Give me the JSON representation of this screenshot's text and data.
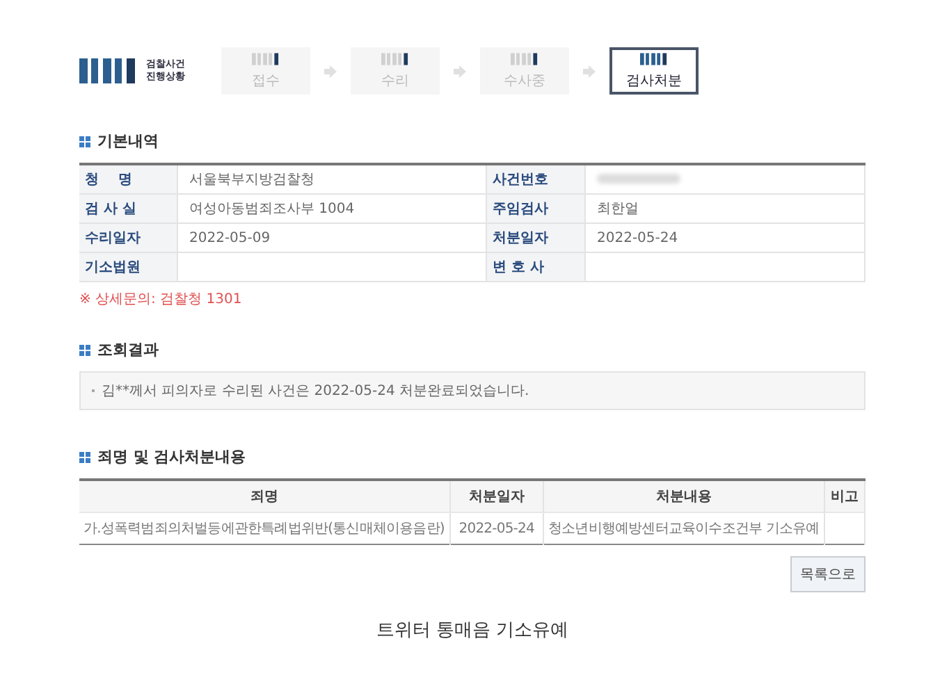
{
  "progress": {
    "title_lines": [
      "검찰사건",
      "진행상황"
    ],
    "steps": [
      {
        "label": "접수",
        "selected": false
      },
      {
        "label": "수리",
        "selected": false
      },
      {
        "label": "수사중",
        "selected": false
      },
      {
        "label": "검사처분",
        "selected": true
      }
    ]
  },
  "basic_info": {
    "title": "기본내역",
    "rows": [
      [
        {
          "label": "청    명",
          "value": "서울북부지방검찰청"
        },
        {
          "label": "사건번호",
          "redacted": true
        }
      ],
      [
        {
          "label": "검 사 실",
          "value": "여성아동범죄조사부 1004"
        },
        {
          "label": "주임검사",
          "value": "최한얼"
        }
      ],
      [
        {
          "label": "수리일자",
          "value": "2022-05-09"
        },
        {
          "label": "처분일자",
          "value": "2022-05-24"
        }
      ],
      [
        {
          "label": "기소법원"
        },
        {
          "label": "변 호 사"
        }
      ]
    ],
    "note": "※ 상세문의: 검찰청 1301"
  },
  "result": {
    "title": "조회결과",
    "message": "김**께서 피의자로 수리된 사건은 2022-05-24 처분완료되었습니다."
  },
  "disposition": {
    "title": "죄명 및 검사처분내용",
    "columns": [
      "죄명",
      "처분일자",
      "처분내용",
      "비고"
    ],
    "rows": [
      [
        "가.성폭력범죄의처벌등에관한특례법위반(통신매체이용음란)",
        "2022-05-24",
        "청소년비행예방센터교육이수조건부 기소유예",
        null
      ]
    ]
  },
  "list_button": "목록으로",
  "caption": "트위터 통매음 기소유예"
}
